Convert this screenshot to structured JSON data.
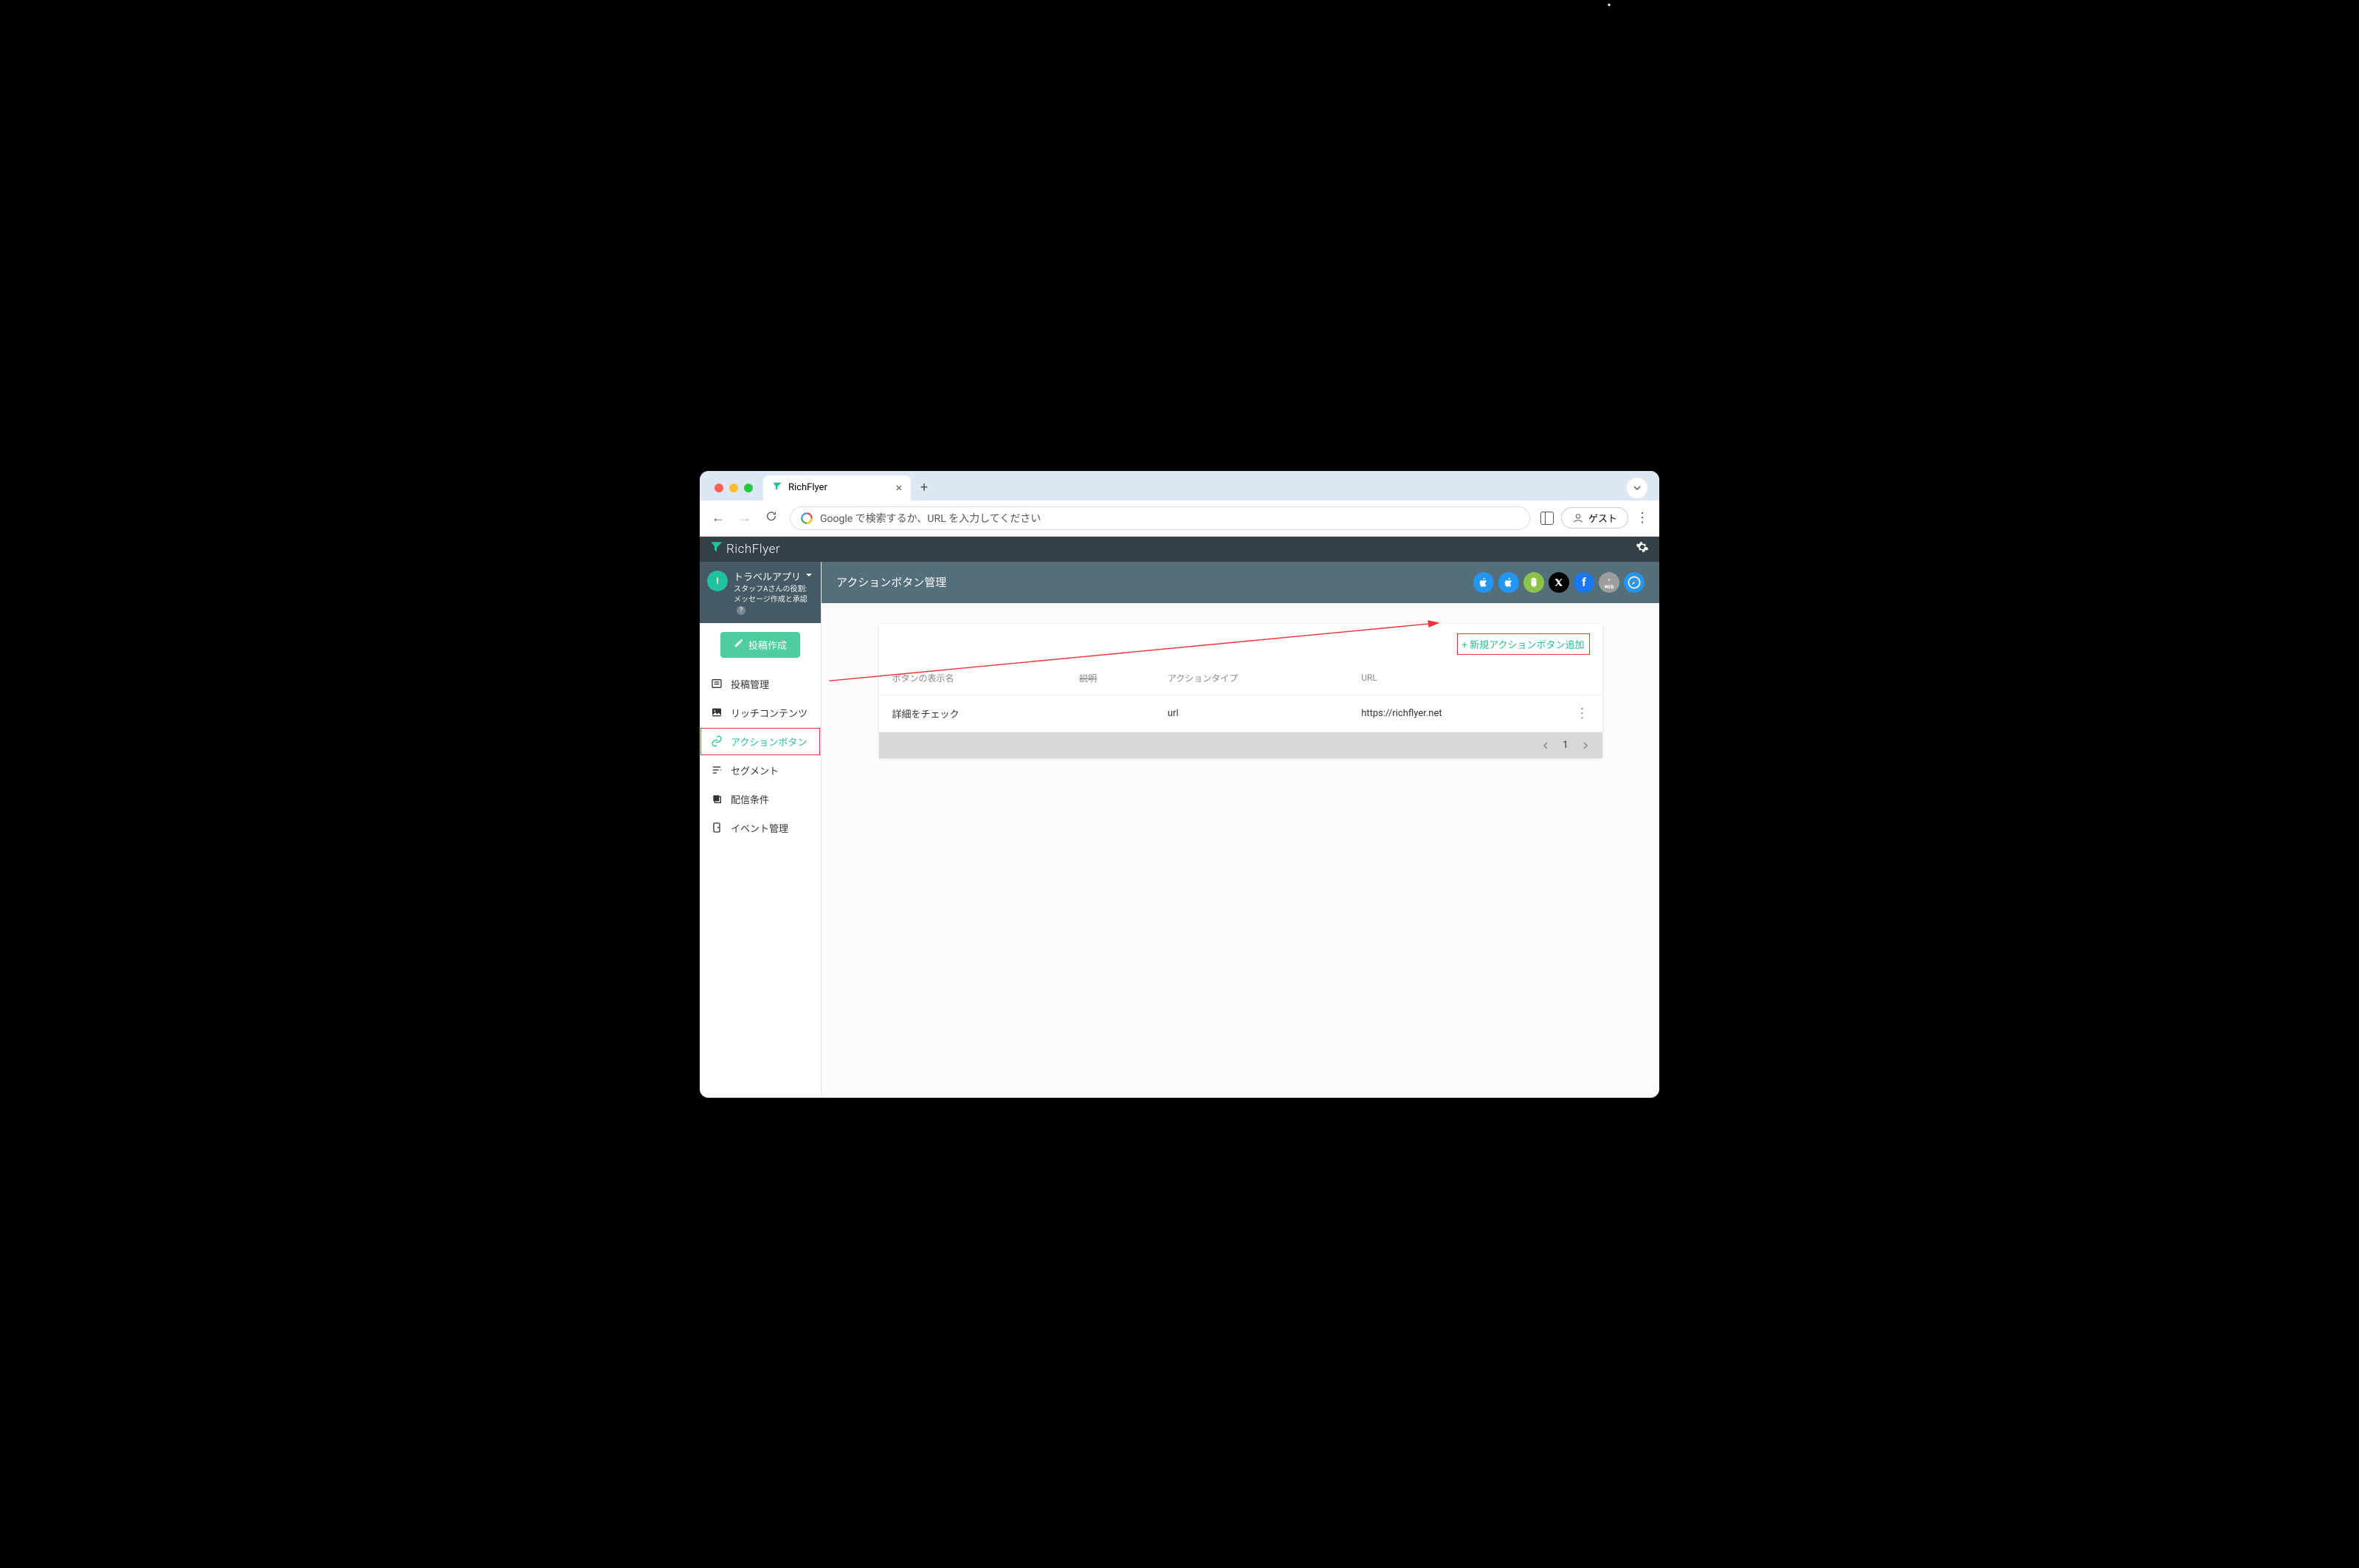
{
  "browser": {
    "tab_title": "RichFlyer",
    "address_placeholder": "Google で検索するか、URL を入力してください",
    "guest_label": "ゲスト"
  },
  "app": {
    "brand": "RichFlyer",
    "site_name": "トラベルアプリ",
    "role_line1": "スタッフAさんの役割:",
    "role_line2": "メッセージ作成と承認",
    "compose_label": "投稿作成"
  },
  "nav": {
    "items": [
      {
        "label": "投稿管理"
      },
      {
        "label": "リッチコンテンツ"
      },
      {
        "label": "アクションボタン"
      },
      {
        "label": "セグメント"
      },
      {
        "label": "配信条件"
      },
      {
        "label": "イベント管理"
      }
    ]
  },
  "main": {
    "title": "アクションボタン管理",
    "add_button": "+ 新規アクションボタン追加"
  },
  "table": {
    "columns": {
      "display_name": "ボタンの表示名",
      "description": "説明",
      "action_type": "アクションタイプ",
      "url": "URL"
    },
    "rows": [
      {
        "display_name": "詳細をチェック",
        "description": "",
        "action_type": "url",
        "url": "https://richflyer.net"
      }
    ]
  },
  "pager": {
    "current": "1"
  },
  "platform_web_label": "WEB"
}
